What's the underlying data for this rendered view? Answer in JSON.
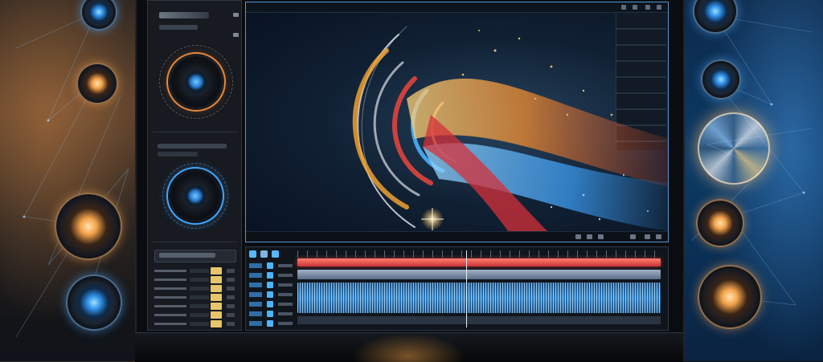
{
  "accent": {
    "blue": "#3ea6ff",
    "orange": "#e9883a",
    "red": "#e0443c",
    "gold": "#e8c46a"
  },
  "left_panel": {
    "header_title": "",
    "header_sub": "",
    "effect_section_label": "",
    "mixer_section_label": "",
    "mixer_channels": [
      {
        "label": ""
      },
      {
        "label": ""
      },
      {
        "label": ""
      },
      {
        "label": ""
      },
      {
        "label": ""
      },
      {
        "label": ""
      },
      {
        "label": ""
      },
      {
        "label": ""
      },
      {
        "label": ""
      }
    ]
  },
  "preview": {
    "title": "",
    "timecode": "",
    "toolbar_icons": [
      "toggle-icon",
      "grid-icon",
      "expand-icon",
      "window-icon"
    ]
  },
  "timeline": {
    "toolbar_icons": [
      "select-icon",
      "cut-icon",
      "snap-icon"
    ],
    "tracks": [
      {
        "name": "",
        "kind": "video",
        "color": "#e0443c"
      },
      {
        "name": "",
        "kind": "video",
        "color": "#7f94ad"
      },
      {
        "name": "",
        "kind": "audio",
        "color": "#2b7cc2"
      },
      {
        "name": "",
        "kind": "audio",
        "color": "#2a3442"
      }
    ]
  },
  "side_orbs": {
    "left": [
      "lens-icon",
      "lens-icon",
      "lens-icon",
      "lens-icon"
    ],
    "right": [
      "lens-icon",
      "lens-icon",
      "light-burst-icon",
      "lens-icon",
      "lens-icon"
    ]
  }
}
